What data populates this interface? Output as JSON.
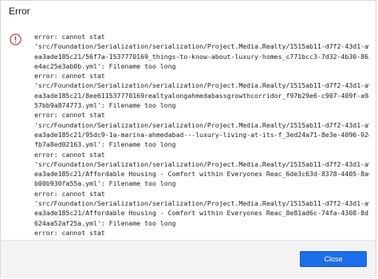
{
  "window": {
    "title": "Error"
  },
  "icon": {
    "name": "error-icon",
    "color": "#c62828"
  },
  "log_lines": [
    "error: cannot stat",
    "'src/Foundation/Serialization/serialization/Project.Media.Realty/1515ab11-d7f2-43d1-a9d0-",
    "ea3ade185c21/56f7a-1537770169_things-to-know-about-luxury-homes_c771bcc3-7d32-4b30-863c-",
    "e4ac25e3ab0b.yml': Filename too long",
    "error: cannot stat",
    "'src/Foundation/Serialization/serialization/Project.Media.Realty/1515ab11-d7f2-43d1-a9d0-",
    "ea3ade185c21/8ee611537770169realtyalongahmedabassgrowthcorridor_f97b29e6-c907-409f-a942-",
    "57bb9a874773.yml': Filename too long",
    "error: cannot stat",
    "'src/Foundation/Serialization/serialization/Project.Media.Realty/1515ab11-d7f2-43d1-a9d0-",
    "ea3ade185c21/95dc9-1a-marina-ahmedabad---luxury-living-at-its-f_3ed24a71-8e3e-4096-92dc-",
    "fb7a8ed02163.yml': Filename too long",
    "error: cannot stat",
    "'src/Foundation/Serialization/serialization/Project.Media.Realty/1515ab11-d7f2-43d1-a9d0-",
    "ea3ade185c21/Affordable Housing - Comfort within Everyones Reac_6de3c63d-8378-4405-8a63-",
    "b00b930fa55a.yml': Filename too long",
    "error: cannot stat",
    "'src/Foundation/Serialization/serialization/Project.Media.Realty/1515ab11-d7f2-43d1-a9d0-",
    "ea3ade185c21/Affordable Housing - Comfort within Everyones Reac_8e81ad6c-74fa-4308-8dcc-",
    "624aa52af25a.yml': Filename too long",
    "error: cannot stat",
    "'src/Foundation/Serialization/serialization/Project.Media.Realty/1515ab11-d7f2-43d1-a9d0-"
  ],
  "footer": {
    "close_label": "Close",
    "accent": "#1c6ee8"
  }
}
